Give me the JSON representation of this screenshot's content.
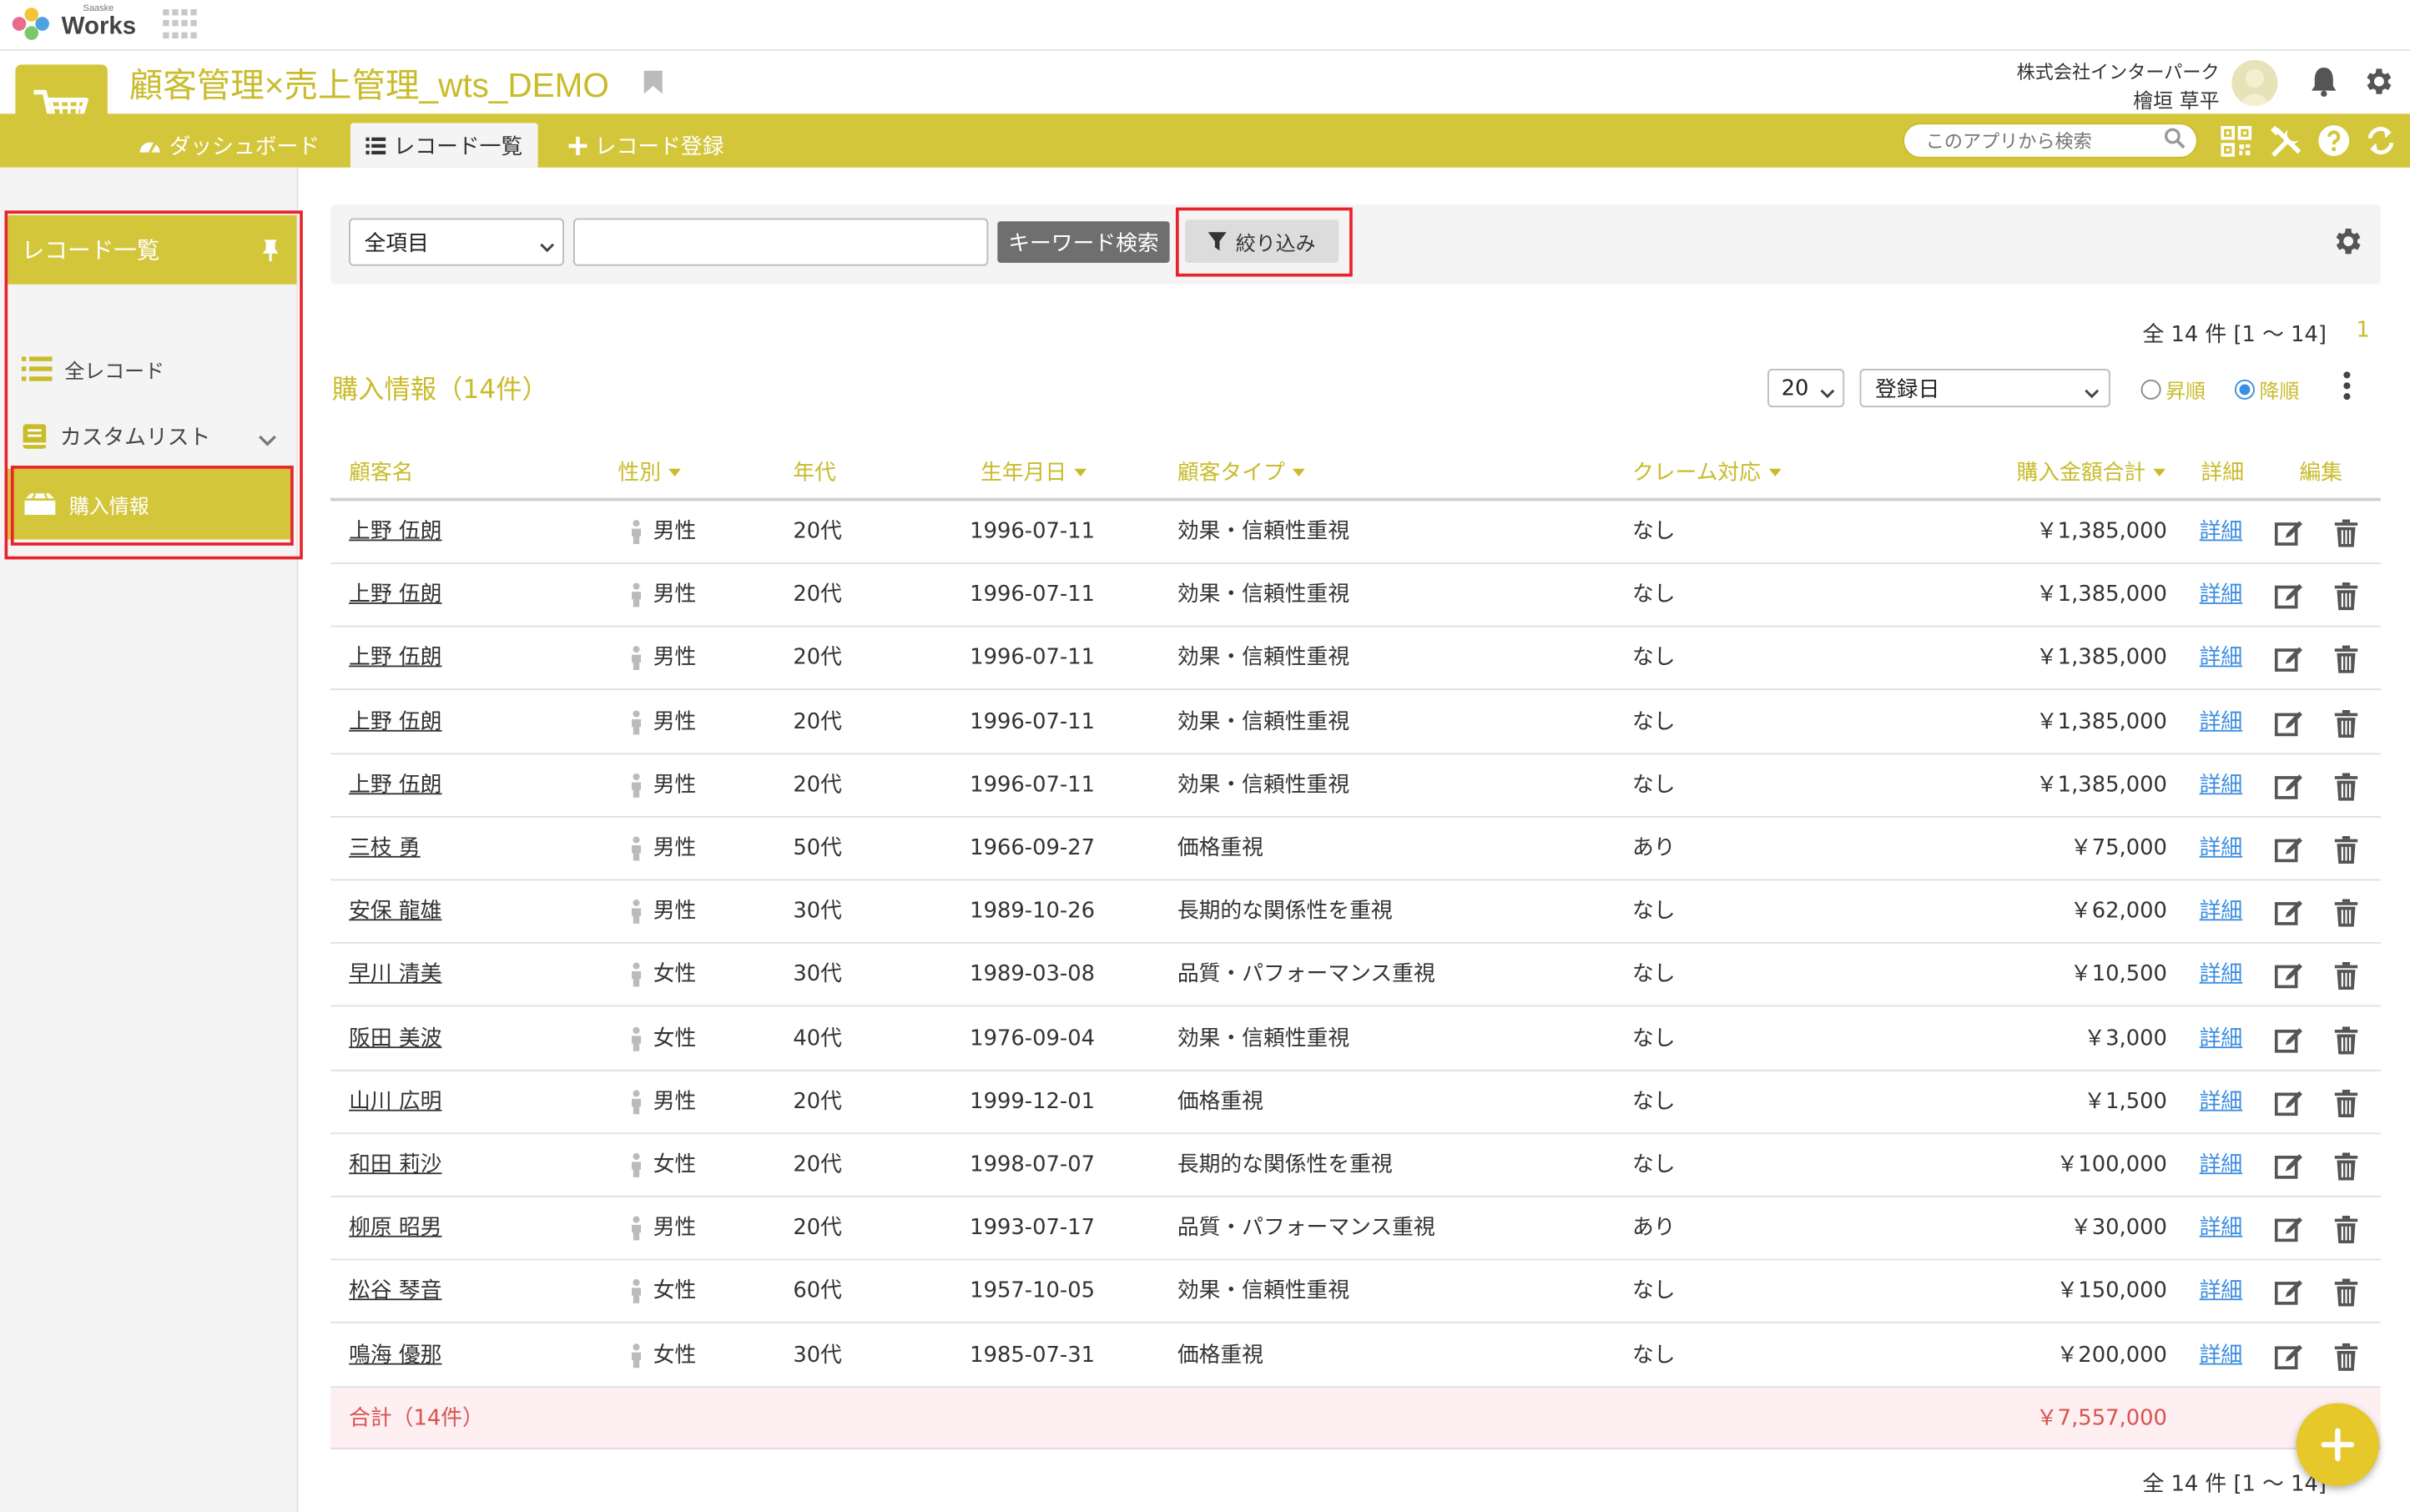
{
  "topbar": {
    "brand": "Works",
    "brand_sub": "Saaske"
  },
  "header": {
    "app_title": "顧客管理×売上管理_wts_DEMO",
    "company": "株式会社インターパーク",
    "user": "檜垣 草平"
  },
  "nav": {
    "tabs": [
      {
        "label": "ダッシュボード",
        "icon": "dashboard-icon"
      },
      {
        "label": "レコード一覧",
        "icon": "list-icon",
        "active": true
      },
      {
        "label": "レコード登録",
        "icon": "plus-icon"
      }
    ],
    "search_placeholder": "このアプリから検索"
  },
  "sidebar": {
    "heading": "レコード一覧",
    "items": [
      {
        "label": "全レコード",
        "icon": "list-icon"
      },
      {
        "label": "カスタムリスト",
        "icon": "book-icon"
      },
      {
        "label": "購入情報",
        "icon": "box-icon",
        "active": true
      }
    ]
  },
  "filter": {
    "field_select": "全項目",
    "keyword_value": "",
    "keyword_button": "キーワード検索",
    "filter_button": "絞り込み"
  },
  "list": {
    "title": "購入情報（14件）",
    "count": "全 14 件 [1 〜 14]",
    "count_bottom": "全 14 件 [1 〜 14]",
    "page": "1",
    "per_page": "20",
    "sort_field": "登録日",
    "sort_asc": "昇順",
    "sort_desc": "降順",
    "sort_selected": "降順"
  },
  "table": {
    "columns": [
      "顧客名",
      "性別",
      "年代",
      "生年月日",
      "顧客タイプ",
      "クレーム対応",
      "購入金額合計",
      "詳細",
      "編集"
    ],
    "detail_label": "詳細",
    "rows": [
      {
        "name": "上野 伍朗",
        "gender": "男性",
        "age": "20代",
        "birth": "1996-07-11",
        "type": "効果・信頼性重視",
        "claim": "なし",
        "amount": "￥1,385,000"
      },
      {
        "name": "上野 伍朗",
        "gender": "男性",
        "age": "20代",
        "birth": "1996-07-11",
        "type": "効果・信頼性重視",
        "claim": "なし",
        "amount": "￥1,385,000"
      },
      {
        "name": "上野 伍朗",
        "gender": "男性",
        "age": "20代",
        "birth": "1996-07-11",
        "type": "効果・信頼性重視",
        "claim": "なし",
        "amount": "￥1,385,000"
      },
      {
        "name": "上野 伍朗",
        "gender": "男性",
        "age": "20代",
        "birth": "1996-07-11",
        "type": "効果・信頼性重視",
        "claim": "なし",
        "amount": "￥1,385,000"
      },
      {
        "name": "上野 伍朗",
        "gender": "男性",
        "age": "20代",
        "birth": "1996-07-11",
        "type": "効果・信頼性重視",
        "claim": "なし",
        "amount": "￥1,385,000"
      },
      {
        "name": "三枝 勇",
        "gender": "男性",
        "age": "50代",
        "birth": "1966-09-27",
        "type": "価格重視",
        "claim": "あり",
        "amount": "￥75,000"
      },
      {
        "name": "安保 龍雄",
        "gender": "男性",
        "age": "30代",
        "birth": "1989-10-26",
        "type": "長期的な関係性を重視",
        "claim": "なし",
        "amount": "￥62,000"
      },
      {
        "name": "早川 清美",
        "gender": "女性",
        "age": "30代",
        "birth": "1989-03-08",
        "type": "品質・パフォーマンス重視",
        "claim": "なし",
        "amount": "￥10,500"
      },
      {
        "name": "阪田 美波",
        "gender": "女性",
        "age": "40代",
        "birth": "1976-09-04",
        "type": "効果・信頼性重視",
        "claim": "なし",
        "amount": "￥3,000"
      },
      {
        "name": "山川 広明",
        "gender": "男性",
        "age": "20代",
        "birth": "1999-12-01",
        "type": "価格重視",
        "claim": "なし",
        "amount": "￥1,500"
      },
      {
        "name": "和田 莉沙",
        "gender": "女性",
        "age": "20代",
        "birth": "1998-07-07",
        "type": "長期的な関係性を重視",
        "claim": "なし",
        "amount": "￥100,000"
      },
      {
        "name": "柳原 昭男",
        "gender": "男性",
        "age": "20代",
        "birth": "1993-07-17",
        "type": "品質・パフォーマンス重視",
        "claim": "あり",
        "amount": "￥30,000"
      },
      {
        "name": "松谷 琴音",
        "gender": "女性",
        "age": "60代",
        "birth": "1957-10-05",
        "type": "効果・信頼性重視",
        "claim": "なし",
        "amount": "￥150,000"
      },
      {
        "name": "鳴海 優那",
        "gender": "女性",
        "age": "30代",
        "birth": "1985-07-31",
        "type": "価格重視",
        "claim": "なし",
        "amount": "￥200,000"
      }
    ],
    "total_label": "合計（14件）",
    "total_value": "￥7,557,000"
  },
  "colors": {
    "accent": "#d4c63b",
    "accent_text": "#c9bb2a",
    "highlight_box": "#e8242b",
    "link": "#3b8de0",
    "total_text": "#d9534f",
    "fab": "#e7c82a"
  }
}
